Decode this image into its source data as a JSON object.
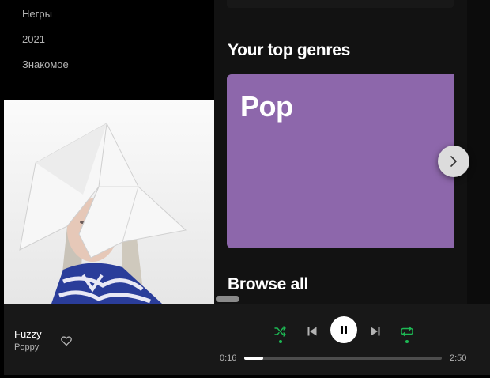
{
  "sidebar": {
    "playlists": [
      {
        "label": "Негры"
      },
      {
        "label": "2021"
      },
      {
        "label": "Знакомое"
      }
    ]
  },
  "main": {
    "genres_heading": "Your top genres",
    "genre_card": {
      "label": "Pop",
      "color": "#8d67ab"
    },
    "browse_heading": "Browse all"
  },
  "player": {
    "track_title": "Fuzzy",
    "artist": "Poppy",
    "time_elapsed": "0:16",
    "time_total": "2:50",
    "progress_fraction": 0.094,
    "shuffle_on": true,
    "repeat_on": true,
    "is_playing": true
  },
  "colors": {
    "accent": "#1db954",
    "background": "#121212",
    "player_bg": "#181818"
  },
  "icons": {
    "like": "heart-icon",
    "shuffle": "shuffle-icon",
    "previous": "skip-back-icon",
    "play_pause": "pause-icon",
    "next": "skip-forward-icon",
    "repeat": "repeat-icon",
    "carousel_next": "chevron-right-icon"
  }
}
